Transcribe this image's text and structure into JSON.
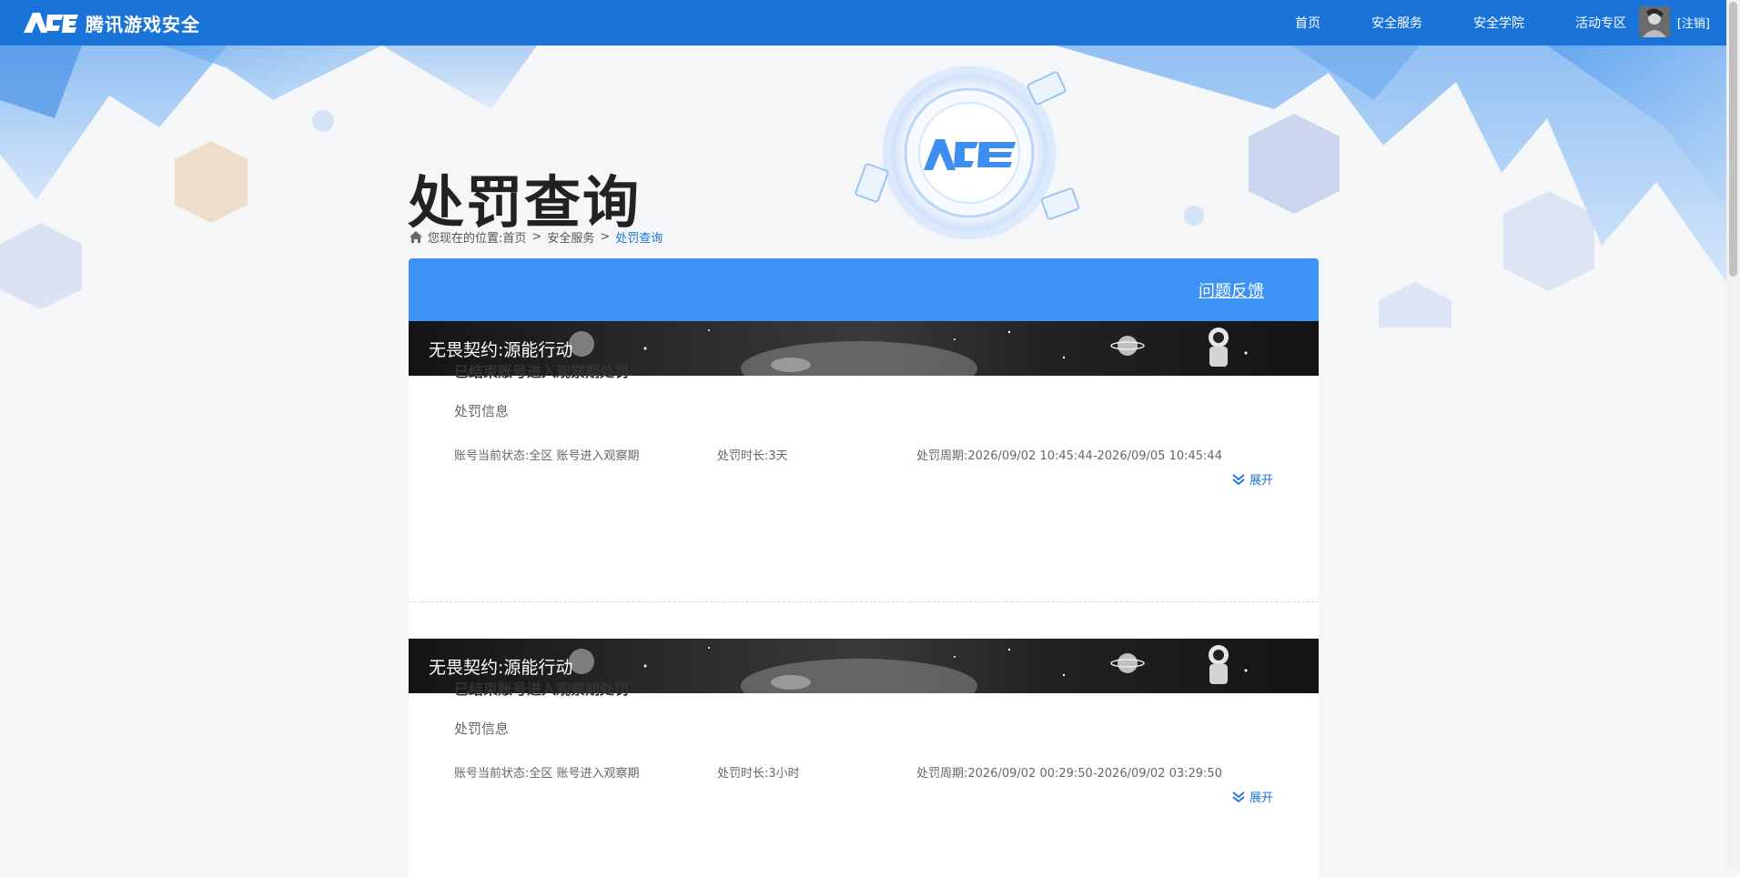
{
  "header": {
    "brand": "腾讯游戏安全",
    "nav": [
      {
        "label": "首页"
      },
      {
        "label": "安全服务"
      },
      {
        "label": "安全学院"
      },
      {
        "label": "活动专区"
      }
    ],
    "logout": "[注销]"
  },
  "page": {
    "title": "处罚查询",
    "breadcrumb": {
      "prefix": "您现在的位置:",
      "items": [
        "首页",
        "安全服务"
      ],
      "separator": ">",
      "current": "处罚查询"
    },
    "feedback": "问题反馈"
  },
  "records": [
    {
      "game": "无畏契约:源能行动",
      "title": "已结束账号进入观察期处罚",
      "subtitle": "处罚信息",
      "status": "账号当前状态:全区 账号进入观察期",
      "duration": "处罚时长:3天",
      "period": "处罚周期:2026/09/02 10:45:44-2026/09/05 10:45:44",
      "expand": "展开"
    },
    {
      "game": "无畏契约:源能行动",
      "title": "已结束账号进入观察期处罚",
      "subtitle": "处罚信息",
      "status": "账号当前状态:全区 账号进入观察期",
      "duration": "处罚时长:3小时",
      "period": "处罚周期:2026/09/02 00:29:50-2026/09/02 03:29:50",
      "expand": "展开"
    }
  ],
  "colors": {
    "nav_bg": "#1a73d9",
    "panel_head": "#3d93f5",
    "link": "#1a73d9"
  },
  "icons": [
    "ace-logo-icon",
    "home-icon",
    "chevron-double-down-icon"
  ]
}
